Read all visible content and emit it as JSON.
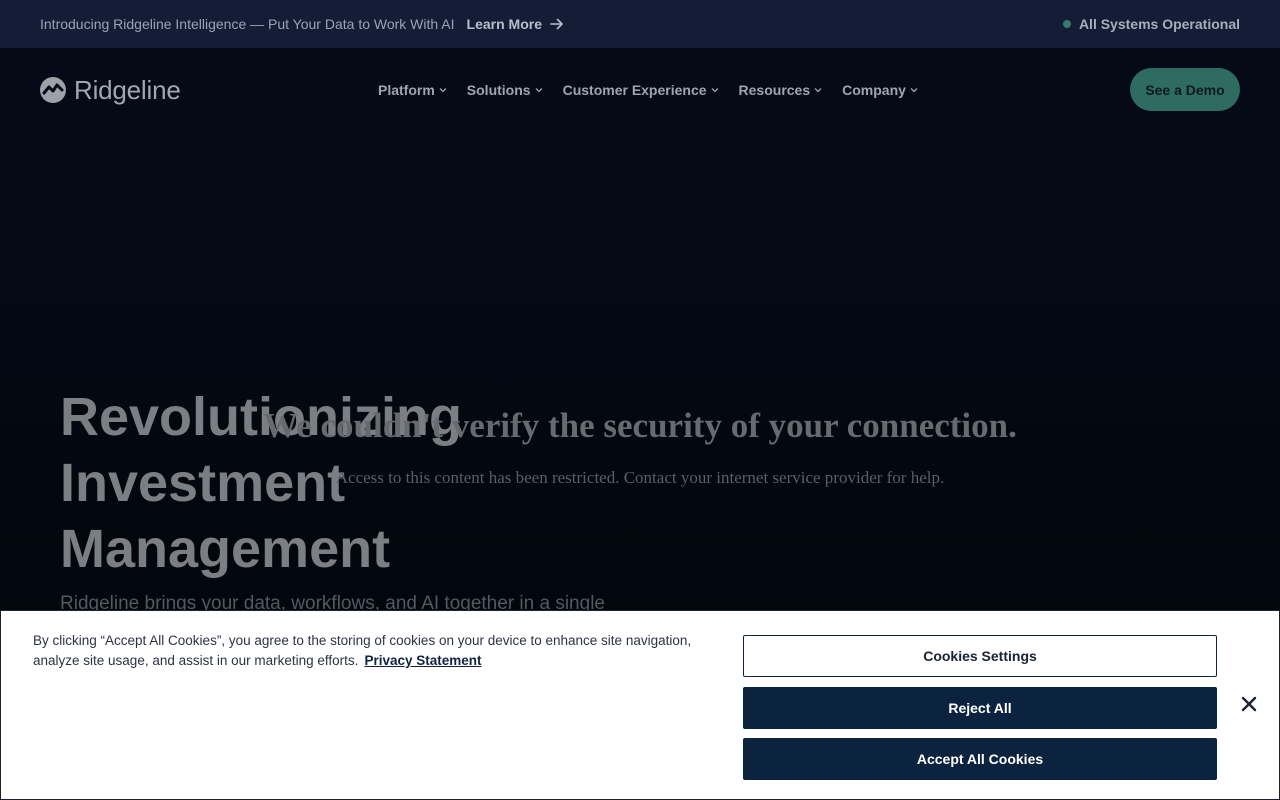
{
  "announcement": {
    "message": "Introducing Ridgeline Intelligence — Put Your Data to Work With AI",
    "learn_more": "Learn More",
    "status": "All Systems Operational",
    "status_color": "#3a7b67"
  },
  "nav": {
    "brand": "Ridgeline",
    "items": [
      {
        "label": "Platform"
      },
      {
        "label": "Solutions"
      },
      {
        "label": "Customer Experience"
      },
      {
        "label": "Resources"
      },
      {
        "label": "Company"
      }
    ],
    "cta": "See a Demo"
  },
  "hero": {
    "title_lines": [
      "Revolutionizing",
      "Investment",
      "Management"
    ],
    "subtitle": "Ridgeline brings your data, workflows, and AI together in a single"
  },
  "block_notice": {
    "title": "We couldn't verify the security of your connection.",
    "message": "Access to this content has been restricted. Contact your internet service provider for help."
  },
  "cookie_banner": {
    "text": "By clicking “Accept All Cookies”, you agree to the storing of cookies on your device to enhance site navigation, analyze site usage, and assist in our marketing efforts.",
    "privacy_link": "Privacy Statement",
    "settings_button": "Cookies Settings",
    "reject_button": "Reject All",
    "accept_button": "Accept All Cookies"
  },
  "colors": {
    "accent": "#2e6b60",
    "navy": "#0c2340",
    "announce_bg": "#131d36"
  }
}
